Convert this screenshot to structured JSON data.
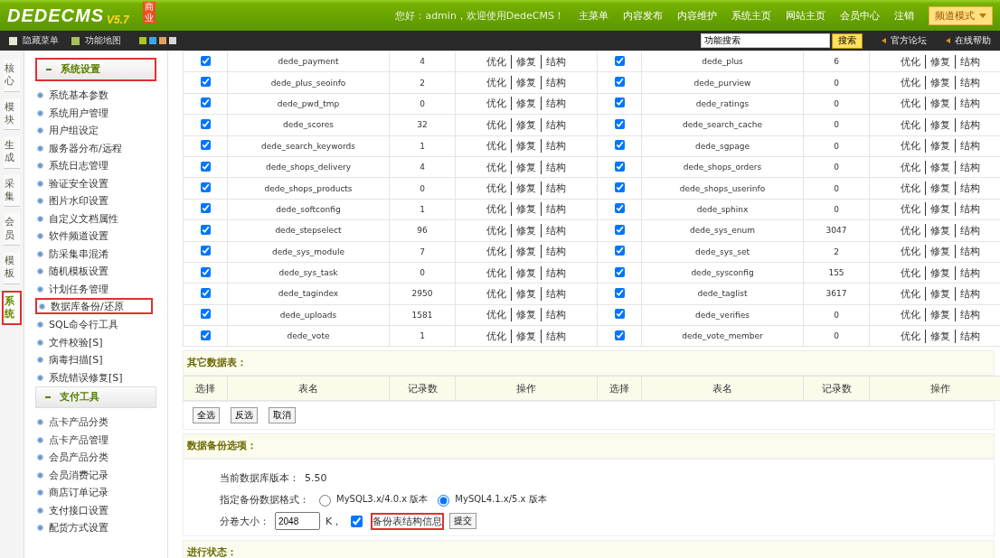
{
  "header": {
    "logo": "DEDECMS",
    "badge": "商业",
    "version": "V5.7",
    "greeting": "您好：admin，欢迎使用DedeCMS！",
    "nav": [
      "主菜单",
      "内容发布",
      "内容维护",
      "系统主页",
      "网站主页",
      "会员中心",
      "注销"
    ],
    "mode_button": "频道模式"
  },
  "toolbar": {
    "hide_menu": "隐藏菜单",
    "function_map": "功能地图",
    "search": {
      "value": "功能搜索",
      "button": "搜索"
    },
    "links": [
      "官方论坛",
      "在线帮助"
    ]
  },
  "side_tabs": [
    {
      "label": "核心",
      "selected": false,
      "highlighted": false
    },
    {
      "label": "模块",
      "selected": false,
      "highlighted": false
    },
    {
      "label": "生成",
      "selected": false,
      "highlighted": false
    },
    {
      "label": "采集",
      "selected": false,
      "highlighted": false
    },
    {
      "label": "会员",
      "selected": false,
      "highlighted": false
    },
    {
      "label": "模板",
      "selected": false,
      "highlighted": false
    },
    {
      "label": "系统",
      "selected": true,
      "highlighted": true
    }
  ],
  "sidebar": [
    {
      "title": "系统设置",
      "highlighted": true,
      "items": [
        {
          "label": "系统基本参数",
          "selected": false
        },
        {
          "label": "系统用户管理",
          "selected": false
        },
        {
          "label": "用户组设定",
          "selected": false
        },
        {
          "label": "服务器分布/远程",
          "selected": false
        },
        {
          "label": "系统日志管理",
          "selected": false
        },
        {
          "label": "验证安全设置",
          "selected": false
        },
        {
          "label": "图片水印设置",
          "selected": false
        },
        {
          "label": "自定义文档属性",
          "selected": false
        },
        {
          "label": "软件频道设置",
          "selected": false
        },
        {
          "label": "防采集串混淆",
          "selected": false
        },
        {
          "label": "随机模板设置",
          "selected": false
        },
        {
          "label": "计划任务管理",
          "selected": false
        },
        {
          "label": "数据库备份/还原",
          "selected": true
        },
        {
          "label": "SQL命令行工具",
          "selected": false
        },
        {
          "label": "文件校验[S]",
          "selected": false
        },
        {
          "label": "病毒扫描[S]",
          "selected": false
        },
        {
          "label": "系统错误修复[S]",
          "selected": false
        }
      ]
    },
    {
      "title": "支付工具",
      "highlighted": false,
      "items": [
        {
          "label": "点卡产品分类",
          "selected": false
        },
        {
          "label": "点卡产品管理",
          "selected": false
        },
        {
          "label": "会员产品分类",
          "selected": false
        },
        {
          "label": "会员消费记录",
          "selected": false
        },
        {
          "label": "商店订单记录",
          "selected": false
        },
        {
          "label": "支付接口设置",
          "selected": false
        },
        {
          "label": "配货方式设置",
          "selected": false
        }
      ]
    }
  ],
  "table": {
    "rows": [
      {
        "left": {
          "checked": true,
          "name": "dede_payment",
          "count": "4",
          "actions": [
            "优化",
            "修复",
            "结构"
          ]
        },
        "right": {
          "checked": true,
          "name": "dede_plus",
          "count": "6",
          "actions": [
            "优化",
            "修复",
            "结构"
          ]
        }
      },
      {
        "left": {
          "checked": true,
          "name": "dede_plus_seoinfo",
          "count": "2",
          "actions": [
            "优化",
            "修复",
            "结构"
          ]
        },
        "right": {
          "checked": true,
          "name": "dede_purview",
          "count": "0",
          "actions": [
            "优化",
            "修复",
            "结构"
          ]
        }
      },
      {
        "left": {
          "checked": true,
          "name": "dede_pwd_tmp",
          "count": "0",
          "actions": [
            "优化",
            "修复",
            "结构"
          ]
        },
        "right": {
          "checked": true,
          "name": "dede_ratings",
          "count": "0",
          "actions": [
            "优化",
            "修复",
            "结构"
          ]
        }
      },
      {
        "left": {
          "checked": true,
          "name": "dede_scores",
          "count": "32",
          "actions": [
            "优化",
            "修复",
            "结构"
          ]
        },
        "right": {
          "checked": true,
          "name": "dede_search_cache",
          "count": "0",
          "actions": [
            "优化",
            "修复",
            "结构"
          ]
        }
      },
      {
        "left": {
          "checked": true,
          "name": "dede_search_keywords",
          "count": "1",
          "actions": [
            "优化",
            "修复",
            "结构"
          ]
        },
        "right": {
          "checked": true,
          "name": "dede_sgpage",
          "count": "0",
          "actions": [
            "优化",
            "修复",
            "结构"
          ]
        }
      },
      {
        "left": {
          "checked": true,
          "name": "dede_shops_delivery",
          "count": "4",
          "actions": [
            "优化",
            "修复",
            "结构"
          ]
        },
        "right": {
          "checked": true,
          "name": "dede_shops_orders",
          "count": "0",
          "actions": [
            "优化",
            "修复",
            "结构"
          ]
        }
      },
      {
        "left": {
          "checked": true,
          "name": "dede_shops_products",
          "count": "0",
          "actions": [
            "优化",
            "修复",
            "结构"
          ]
        },
        "right": {
          "checked": true,
          "name": "dede_shops_userinfo",
          "count": "0",
          "actions": [
            "优化",
            "修复",
            "结构"
          ]
        }
      },
      {
        "left": {
          "checked": true,
          "name": "dede_softconfig",
          "count": "1",
          "actions": [
            "优化",
            "修复",
            "结构"
          ]
        },
        "right": {
          "checked": true,
          "name": "dede_sphinx",
          "count": "0",
          "actions": [
            "优化",
            "修复",
            "结构"
          ]
        }
      },
      {
        "left": {
          "checked": true,
          "name": "dede_stepselect",
          "count": "96",
          "actions": [
            "优化",
            "修复",
            "结构"
          ]
        },
        "right": {
          "checked": true,
          "name": "dede_sys_enum",
          "count": "3047",
          "actions": [
            "优化",
            "修复",
            "结构"
          ]
        }
      },
      {
        "left": {
          "checked": true,
          "name": "dede_sys_module",
          "count": "7",
          "actions": [
            "优化",
            "修复",
            "结构"
          ]
        },
        "right": {
          "checked": true,
          "name": "dede_sys_set",
          "count": "2",
          "actions": [
            "优化",
            "修复",
            "结构"
          ]
        }
      },
      {
        "left": {
          "checked": true,
          "name": "dede_sys_task",
          "count": "0",
          "actions": [
            "优化",
            "修复",
            "结构"
          ]
        },
        "right": {
          "checked": true,
          "name": "dede_sysconfig",
          "count": "155",
          "actions": [
            "优化",
            "修复",
            "结构"
          ]
        }
      },
      {
        "left": {
          "checked": true,
          "name": "dede_tagindex",
          "count": "2950",
          "actions": [
            "优化",
            "修复",
            "结构"
          ]
        },
        "right": {
          "checked": true,
          "name": "dede_taglist",
          "count": "3617",
          "actions": [
            "优化",
            "修复",
            "结构"
          ]
        }
      },
      {
        "left": {
          "checked": true,
          "name": "dede_uploads",
          "count": "1581",
          "actions": [
            "优化",
            "修复",
            "结构"
          ]
        },
        "right": {
          "checked": true,
          "name": "dede_verifies",
          "count": "0",
          "actions": [
            "优化",
            "修复",
            "结构"
          ]
        }
      },
      {
        "left": {
          "checked": true,
          "name": "dede_vote",
          "count": "1",
          "actions": [
            "优化",
            "修复",
            "结构"
          ]
        },
        "right": {
          "checked": true,
          "name": "dede_vote_member",
          "count": "0",
          "actions": [
            "优化",
            "修复",
            "结构"
          ]
        }
      }
    ]
  },
  "other_tables": {
    "title": "其它数据表：",
    "columns": [
      "选择",
      "表名",
      "记录数",
      "操作",
      "选择",
      "表名",
      "记录数",
      "操作"
    ],
    "buttons": [
      "全选",
      "反选",
      "取消"
    ]
  },
  "backup": {
    "title": "数据备份选项：",
    "version_label": "当前数据库版本：",
    "version": "5.50",
    "format_label": "指定备份数据格式：",
    "formats": [
      {
        "label": "MySQL3.x/4.0.x 版本",
        "selected": false
      },
      {
        "label": "MySQL4.1.x/5.x 版本",
        "selected": true
      }
    ],
    "size_label": "分卷大小：",
    "size": "2048",
    "unit": "K，",
    "structure": {
      "label": "备份表结构信息",
      "checked": true,
      "highlighted": true
    },
    "submit": "提交"
  },
  "status": {
    "title": "进行状态："
  }
}
